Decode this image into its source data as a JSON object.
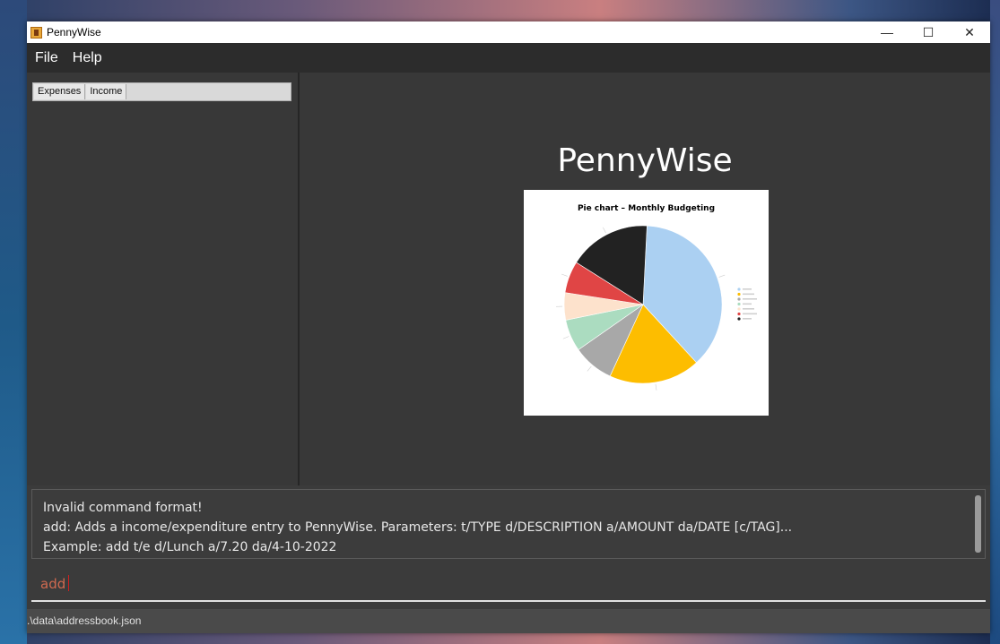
{
  "window": {
    "title": "PennyWise",
    "controls": [
      "—",
      "☐",
      "✕"
    ]
  },
  "menu": {
    "items": [
      "File",
      "Help"
    ]
  },
  "tabs": [
    "Expenses",
    "Income"
  ],
  "main": {
    "app_title": "PennyWise"
  },
  "chart_data": {
    "type": "pie",
    "title": "Pie chart – Monthly Budgeting",
    "values": [
      40,
      20,
      9,
      7,
      6,
      7,
      18
    ],
    "colors": [
      "#abd0f2",
      "#fdbd00",
      "#a8a8a8",
      "#abdcc0",
      "#fde2cc",
      "#e04545",
      "#222222"
    ],
    "legend_position": "right"
  },
  "result": {
    "lines": [
      "Invalid command format!",
      "add: Adds a income/expenditure entry to PennyWise. Parameters: t/TYPE d/DESCRIPTION a/AMOUNT da/DATE [c/TAG]...",
      "Example: add t/e d/Lunch a/7.20 da/4-10-2022"
    ]
  },
  "command": {
    "value": "add"
  },
  "status": {
    "path": ".\\data\\addressbook.json"
  }
}
